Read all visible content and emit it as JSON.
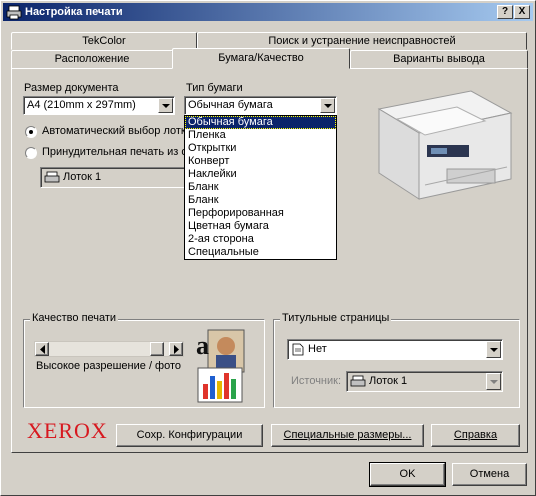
{
  "window": {
    "title": "Настройка печати",
    "help_btn": "?",
    "close_btn": "X"
  },
  "tabs": {
    "row_back": [
      "TekColor",
      "Поиск и устранение неисправностей"
    ],
    "row_front": [
      "Расположение",
      "Бумага/Качество",
      "Варианты вывода"
    ],
    "active": "Бумага/Качество"
  },
  "paper": {
    "size_label": "Размер документа",
    "size_value": "A4 (210mm x 297mm)",
    "type_label": "Тип бумаги",
    "type_value": "Обычная бумага",
    "type_options": [
      "Обычная бумага",
      "Пленка",
      "Открытки",
      "Конверт",
      "Наклейки",
      "Бланк",
      "Бланк",
      "Перфорированная",
      "Цветная бумага",
      "2-ая сторона",
      "Специальные"
    ],
    "auto_select": "Автоматический выбор лотк",
    "force_print": "Принудительная печать из о",
    "tray_value": "Лоток 1"
  },
  "quality": {
    "group_title": "Качество печати",
    "slider_label": "Высокое разрешение / фото",
    "slider_level": 0.95
  },
  "title_pages": {
    "group_title": "Титульные страницы",
    "value": "Нет",
    "source_label": "Источник:",
    "source_value": "Лоток 1"
  },
  "brand": {
    "logo": "XEROX",
    "color": "#d71920"
  },
  "buttons": {
    "save_config": "Сохр. Конфигурации",
    "special_sizes": "Специальные размеры...",
    "help": "Справка",
    "ok": "OK",
    "cancel": "Отмена"
  }
}
